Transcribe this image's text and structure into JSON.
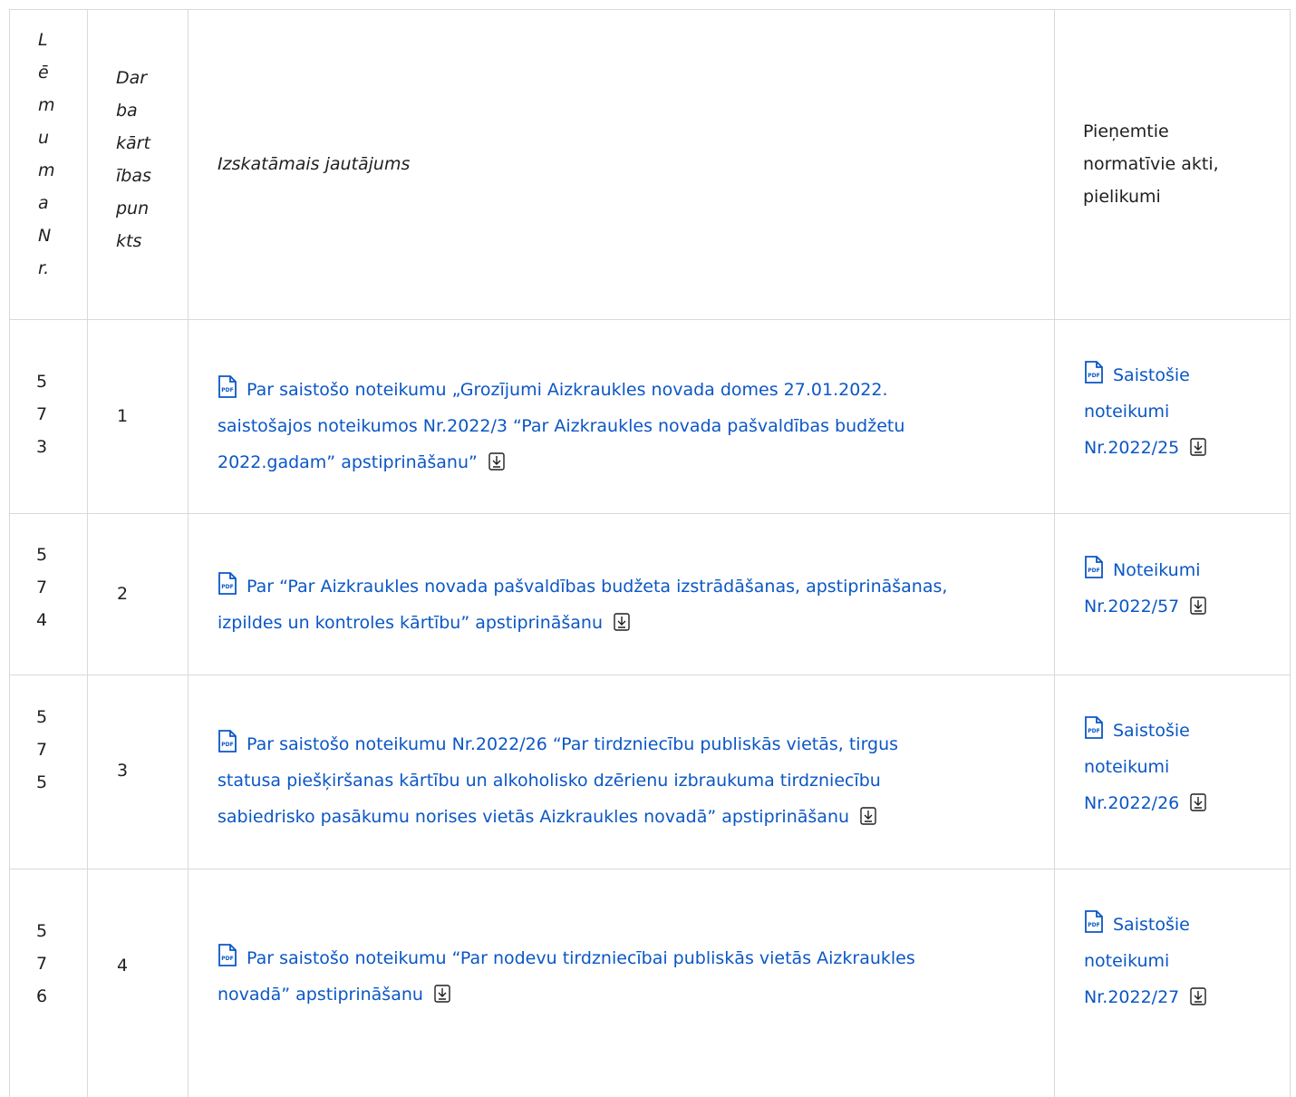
{
  "header": {
    "num_letters": [
      "L",
      "ē",
      "m",
      "u",
      "m",
      "a",
      "N",
      "r."
    ],
    "point_lines": [
      "Dar",
      "ba",
      "kārt",
      "ības",
      "pun",
      "kts"
    ],
    "question": "Izskatāmais jautājums",
    "acts_lines": [
      "Pieņemtie",
      "normatīvie akti,",
      "pielikumi"
    ]
  },
  "rows": [
    {
      "num_digits": [
        "5",
        "7",
        "3"
      ],
      "point": "1",
      "question_lines": [
        "Par saistošo noteikumu „Grozījumi Aizkraukles novada domes 27.01.2022.",
        "saistošajos noteikumos Nr.2022/3 “Par Aizkraukles novada pašvaldības budžetu",
        "2022.gadam” apstiprināšanu”"
      ],
      "act_lines": [
        "Saistošie",
        "noteikumi",
        "Nr.2022/25"
      ]
    },
    {
      "num_digits": [
        "5",
        "7",
        "4"
      ],
      "point": "2",
      "question_lines": [
        "Par “Par Aizkraukles novada pašvaldības budžeta izstrādāšanas, apstiprināšanas,",
        "izpildes un kontroles kārtību” apstiprināšanu"
      ],
      "act_lines": [
        "Noteikumi",
        "Nr.2022/57"
      ]
    },
    {
      "num_digits": [
        "5",
        "7",
        "5"
      ],
      "point": "3",
      "question_lines": [
        "Par saistošo noteikumu Nr.2022/26 “Par tirdzniecību publiskās vietās, tirgus",
        "statusa piešķiršanas kārtību un alkoholisko dzērienu izbraukuma tirdzniecību",
        "sabiedrisko pasākumu norises vietās Aizkraukles novadā” apstiprināšanu"
      ],
      "act_lines": [
        "Saistošie",
        "noteikumi",
        "Nr.2022/26"
      ]
    },
    {
      "num_digits": [
        "5",
        "7",
        "6"
      ],
      "point": "4",
      "question_lines": [
        "Par saistošo noteikumu “Par nodevu tirdzniecībai publiskās vietās Aizkraukles",
        "novadā” apstiprināšanu"
      ],
      "act_lines": [
        "Saistošie",
        "noteikumi",
        "Nr.2022/27"
      ]
    }
  ],
  "icons": {
    "pdf": "pdf-file-icon",
    "download": "download-icon"
  },
  "colors": {
    "link": "#0b57c5",
    "border": "#d9d9d9",
    "text": "#1f1f1f"
  }
}
